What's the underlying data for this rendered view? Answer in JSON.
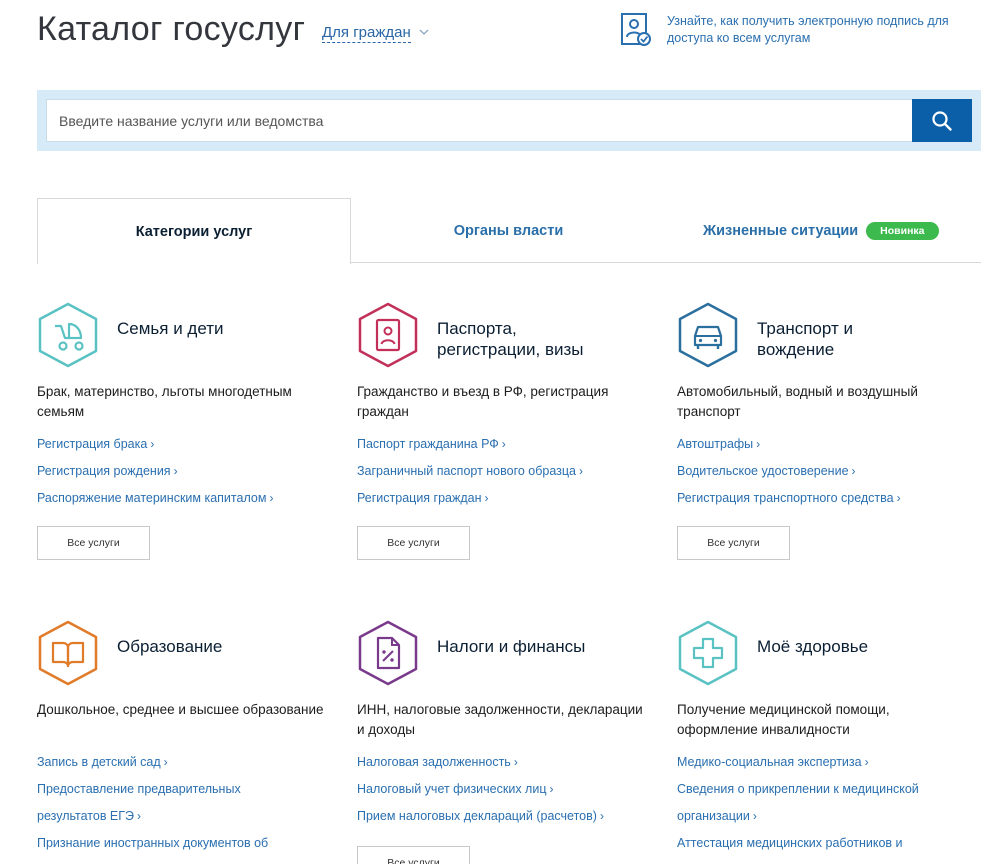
{
  "header": {
    "title": "Каталог госуслуг",
    "audience": "Для граждан",
    "sign_notice": "Узнайте, как получить электронную подпись для доступа ко всем услугам"
  },
  "search": {
    "placeholder": "Введите название услуги или ведомства"
  },
  "tabs": [
    {
      "label": "Категории услуг",
      "active": true
    },
    {
      "label": "Органы власти",
      "active": false
    },
    {
      "label": "Жизненные ситуации",
      "active": false,
      "badge": "Новинка"
    }
  ],
  "all_services_label": "Все услуги",
  "categories": [
    {
      "title_1": "Семья и дети",
      "title_2": "",
      "icon": "stroller-icon",
      "color": "#5ac2c2",
      "desc": "Брак, материнство, льготы многодетным семьям",
      "links": [
        "Регистрация брака",
        "Регистрация рождения",
        "Распоряжение материнским капиталом"
      ]
    },
    {
      "title_1": "Паспорта,",
      "title_2": "регистрации, визы",
      "icon": "passport-icon",
      "color": "#c2305a",
      "desc": "Гражданство и въезд в РФ, регистрация граждан",
      "links": [
        "Паспорт гражданина РФ",
        "Заграничный паспорт нового образца",
        "Регистрация граждан"
      ]
    },
    {
      "title_1": "Транспорт и",
      "title_2": "вождение",
      "icon": "car-icon",
      "color": "#2a6f9e",
      "desc": "Автомобильный, водный и воздушный транспорт",
      "links": [
        "Автоштрафы",
        "Водительское удостоверение",
        "Регистрация транспортного средства"
      ]
    },
    {
      "title_1": "Образование",
      "title_2": "",
      "icon": "book-icon",
      "color": "#e07b2a",
      "desc": "Дошкольное, среднее и высшее образование",
      "links": [
        "Запись в детский сад",
        "Предоставление предварительных результатов ЕГЭ",
        "Признание иностранных документов об"
      ]
    },
    {
      "title_1": "Налоги и финансы",
      "title_2": "",
      "icon": "tax-document-icon",
      "color": "#7a3a8c",
      "desc": "ИНН, налоговые задолженности, декларации и доходы",
      "links": [
        "Налоговая задолженность",
        "Налоговый учет физических лиц",
        "Прием налоговых деклараций (расчетов)"
      ]
    },
    {
      "title_1": "Моё здоровье",
      "title_2": "",
      "icon": "medical-cross-icon",
      "color": "#5ac2c2",
      "desc": "Получение медицинской помощи, оформление инвалидности",
      "links": [
        "Медико-социальная экспертиза",
        "Сведения о прикреплении к медицинской организации",
        "Аттестация медицинских работников и"
      ]
    }
  ]
}
